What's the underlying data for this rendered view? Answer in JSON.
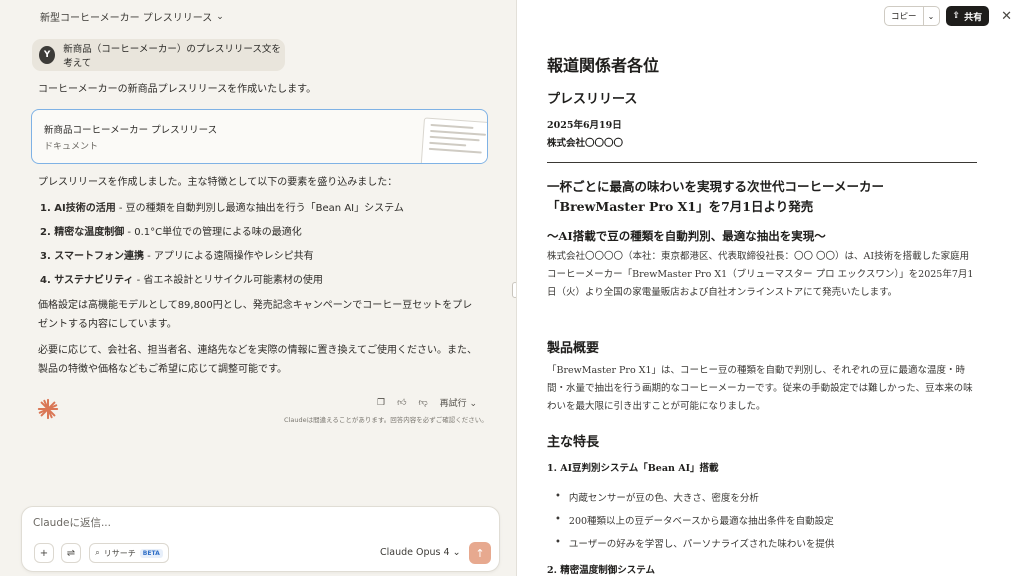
{
  "chat": {
    "title": "新型コーヒーメーカー プレスリリース",
    "user_initial": "Y",
    "user_message": "新商品（コーヒーメーカー）のプレスリリース文を考えて",
    "intro": "コーヒーメーカーの新商品プレスリリースを作成いたします。",
    "artifact": {
      "title": "新商品コーヒーメーカー プレスリリース",
      "type": "ドキュメント"
    },
    "summary": "プレスリリースを作成しました。主な特徴として以下の要素を盛り込みました：",
    "features": [
      {
        "bold": "1. AI技術の活用",
        "text": " - 豆の種類を自動判別し最適な抽出を行う「Bean AI」システム"
      },
      {
        "bold": "2. 精密な温度制御",
        "text": " - 0.1°C単位での管理による味の最適化"
      },
      {
        "bold": "3. スマートフォン連携",
        "text": " - アプリによる遠隔操作やレシピ共有"
      },
      {
        "bold": "4. サステナビリティ",
        "text": " - 省エネ設計とリサイクル可能素材の使用"
      }
    ],
    "price_note": "価格設定は高機能モデルとして89,800円とし、発売記念キャンペーンでコーヒー豆セットをプレゼントする内容にしています。",
    "closing_note": "必要に応じて、会社名、担当者名、連絡先などを実際の情報に置き換えてご使用ください。また、製品の特徴や価格などもご希望に応じて調整可能です。",
    "retry_label": "再試行",
    "disclaimer": "Claudeは間違えることがあります。回答内容を必ずご確認ください。",
    "composer_placeholder": "Claudeに返信...",
    "research_label": "リサーチ",
    "beta_label": "BETA",
    "model_label": "Claude Opus 4",
    "accent_color": "#da7756"
  },
  "toolbar": {
    "copy_label": "コピー",
    "share_label": "共有"
  },
  "document": {
    "heading": "報道関係者各位",
    "release_label": "プレスリリース",
    "date": "2025年6月19日",
    "company": "株式会社〇〇〇〇",
    "headline_line1": "一杯ごとに最高の味わいを実現する次世代コーヒーメーカー",
    "headline_line2": "「BrewMaster Pro X1」を7月1日より発売",
    "subheadline": "〜AI搭載で豆の種類を自動判別、最適な抽出を実現〜",
    "lead": "株式会社〇〇〇〇（本社：東京都港区、代表取締役社長：〇〇 〇〇）は、AI技術を搭載した家庭用コーヒーメーカー「BrewMaster Pro X1（ブリューマスター プロ エックスワン）」を2025年7月1日（火）より全国の家電量販店および自社オンラインストアにて発売いたします。",
    "section_overview": "製品概要",
    "overview_text": "「BrewMaster Pro X1」は、コーヒー豆の種類を自動で判別し、それぞれの豆に最適な温度・時間・水量で抽出を行う画期的なコーヒーメーカーです。従来の手動設定では難しかった、豆本来の味わいを最大限に引き出すことが可能になりました。",
    "section_features": "主な特長",
    "feature1_title": "1. AI豆判別システム「Bean AI」搭載",
    "feature1_bullets": [
      "内蔵センサーが豆の色、大きさ、密度を分析",
      "200種類以上の豆データベースから最適な抽出条件を自動設定",
      "ユーザーの好みを学習し、パーソナライズされた味わいを提供"
    ],
    "feature2_title": "2. 精密温度制御システム"
  }
}
